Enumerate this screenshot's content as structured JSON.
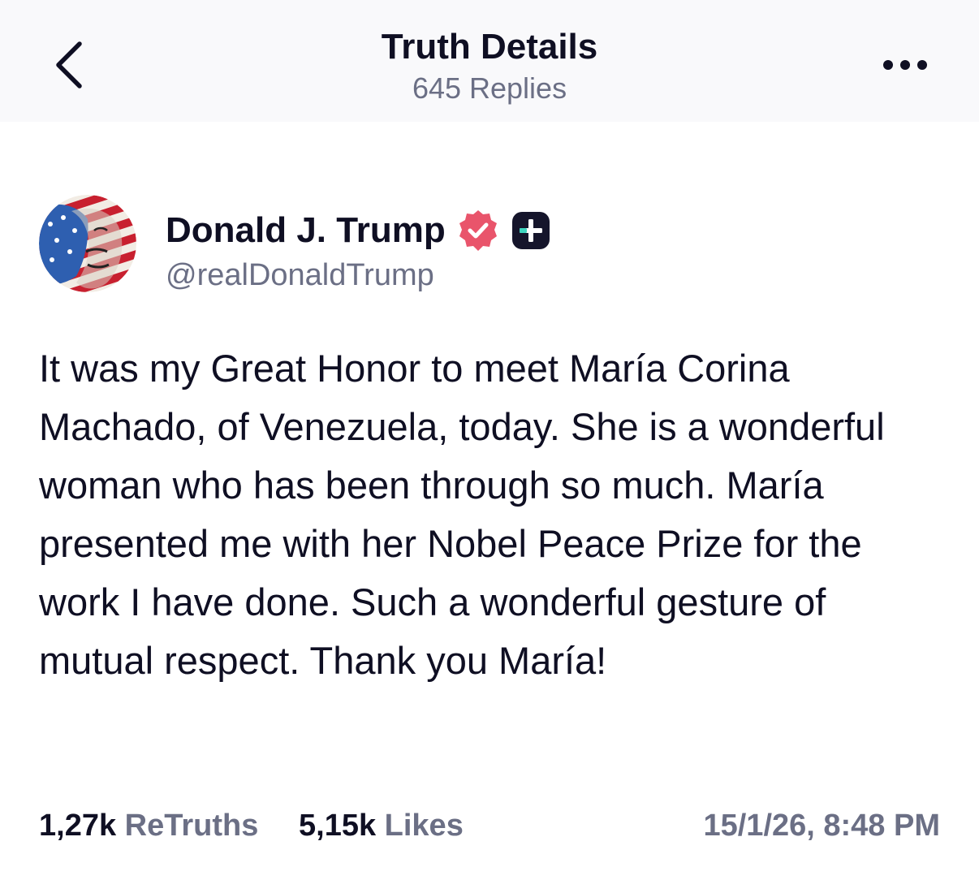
{
  "header": {
    "title": "Truth Details",
    "replies": "645 Replies",
    "back_icon": "chevron-left-icon",
    "more_icon": "ellipsis-horizontal-icon"
  },
  "author": {
    "display_name": "Donald J. Trump",
    "handle": "@realDonaldTrump",
    "verified_icon": "verified-badge-icon",
    "verified_color": "#e9546b",
    "plus_icon": "plus-badge-icon",
    "plus_accent": "#3ed6c0"
  },
  "post": {
    "text": "It was my Great Honor to meet María Corina Machado, of Venezuela, today. She is a wonderful woman who has been through so much. María presented me with her Nobel Peace Prize for the work I have done. Such a wonderful gesture of mutual respect. Thank you María!"
  },
  "stats": {
    "retruths_count": "1,27k",
    "retruths_label": "ReTruths",
    "likes_count": "5,15k",
    "likes_label": "Likes",
    "timestamp": "15/1/26, 8:48 PM"
  }
}
